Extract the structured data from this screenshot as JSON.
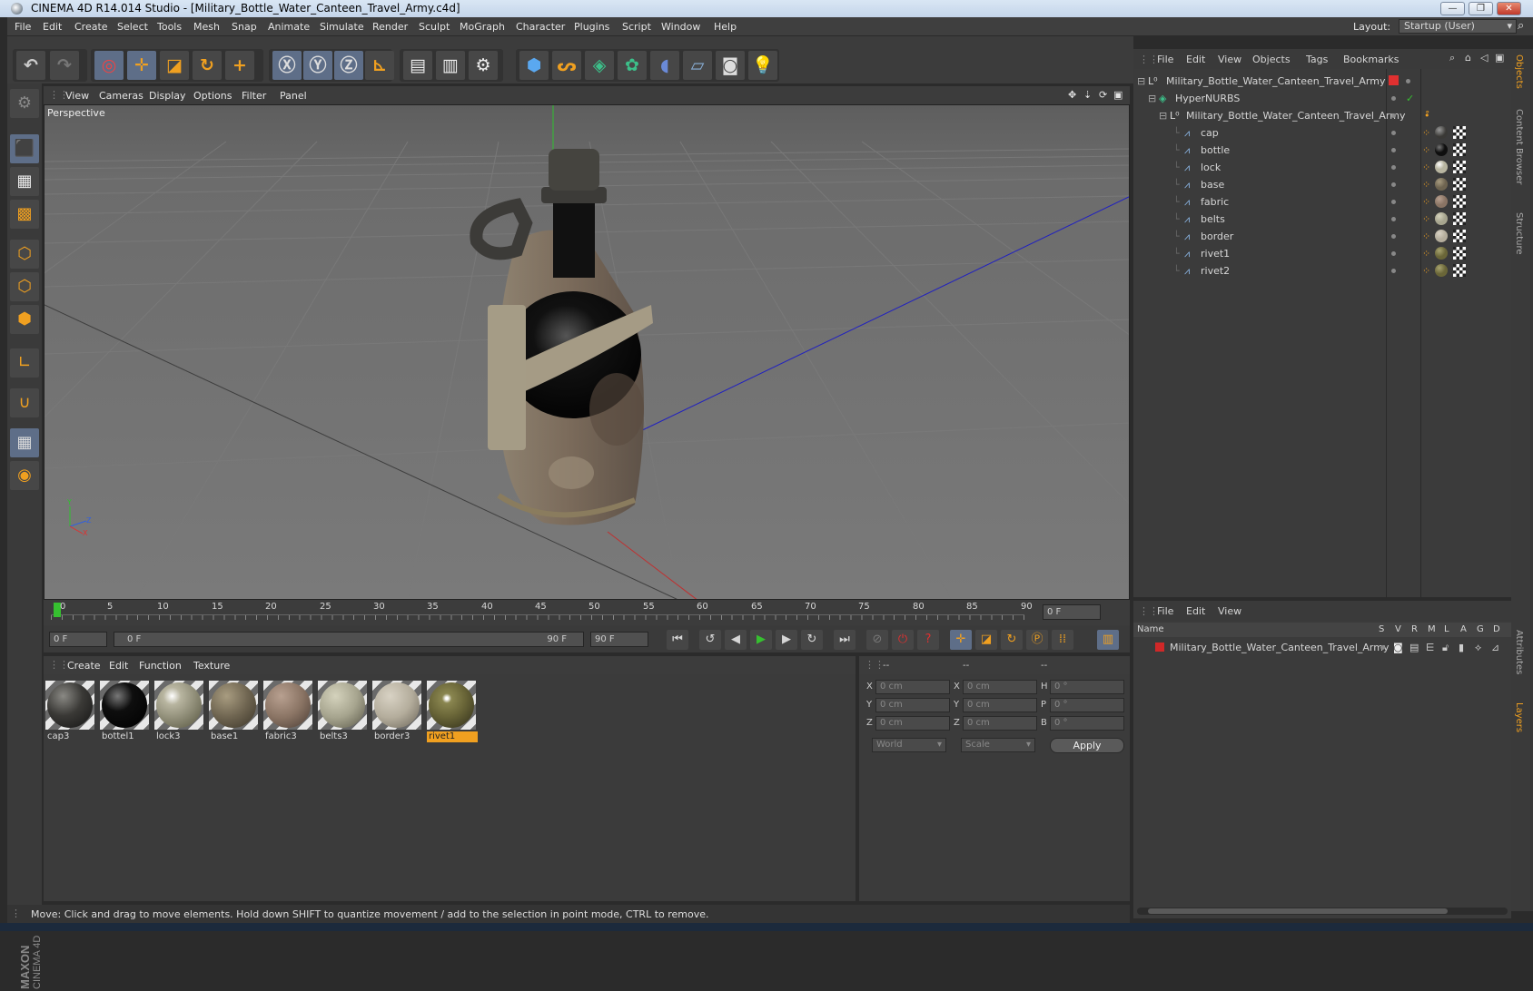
{
  "window": {
    "title": "CINEMA 4D R14.014 Studio - [Military_Bottle_Water_Canteen_Travel_Army.c4d]",
    "minimize": "—",
    "restore": "❐",
    "close": "✕"
  },
  "menubar": {
    "items": [
      "File",
      "Edit",
      "Create",
      "Select",
      "Tools",
      "Mesh",
      "Snap",
      "Animate",
      "Simulate",
      "Render",
      "Sculpt",
      "MoGraph",
      "Character",
      "Plugins",
      "Script",
      "Window",
      "Help"
    ],
    "layout_label": "Layout:",
    "layout_value": "Startup (User)"
  },
  "viewport": {
    "menu": [
      "View",
      "Cameras",
      "Display",
      "Options",
      "Filter",
      "Panel"
    ],
    "label": "Perspective"
  },
  "timeline": {
    "ticks": [
      "0",
      "5",
      "10",
      "15",
      "20",
      "25",
      "30",
      "35",
      "40",
      "45",
      "50",
      "55",
      "60",
      "65",
      "70",
      "75",
      "80",
      "85",
      "90"
    ],
    "current_frame": "0 F",
    "start_field": "0 F",
    "range_start": "0 F",
    "range_end": "90 F",
    "end_field": "90 F"
  },
  "materials": {
    "menu": [
      "Create",
      "Edit",
      "Function",
      "Texture"
    ],
    "items": [
      {
        "name": "cap3",
        "color": "#3a3936"
      },
      {
        "name": "bottel1",
        "color": "#0e0e0e"
      },
      {
        "name": "lock3",
        "color": "#b8b5a0"
      },
      {
        "name": "base1",
        "color": "#6e6450"
      },
      {
        "name": "fabric3",
        "color": "#8a7464"
      },
      {
        "name": "belts3",
        "color": "#a6a48e"
      },
      {
        "name": "border3",
        "color": "#b4ad9c"
      },
      {
        "name": "rivet1",
        "color": "#6a6638"
      }
    ],
    "selected": "rivet1"
  },
  "coords": {
    "headers": [
      "--",
      "--",
      "--"
    ],
    "rows": [
      {
        "a": "X",
        "av": "0 cm",
        "b": "X",
        "bv": "0 cm",
        "c": "H",
        "cv": "0 °"
      },
      {
        "a": "Y",
        "av": "0 cm",
        "b": "Y",
        "bv": "0 cm",
        "c": "P",
        "cv": "0 °"
      },
      {
        "a": "Z",
        "av": "0 cm",
        "b": "Z",
        "bv": "0 cm",
        "c": "B",
        "cv": "0 °"
      }
    ],
    "mode": "World",
    "scale": "Scale",
    "apply": "Apply"
  },
  "objects": {
    "menu": [
      "File",
      "Edit",
      "View",
      "Objects",
      "Tags",
      "Bookmarks"
    ],
    "root": "Military_Bottle_Water_Canteen_Travel_Army",
    "hypernurbs": "HyperNURBS",
    "group": "Military_Bottle_Water_Canteen_Travel_Army",
    "children": [
      {
        "name": "cap",
        "tag": "#3a3936"
      },
      {
        "name": "bottle",
        "tag": "#0e0e0e"
      },
      {
        "name": "lock",
        "tag": "#b8b5a0"
      },
      {
        "name": "base",
        "tag": "#6e6450"
      },
      {
        "name": "fabric",
        "tag": "#8a7464"
      },
      {
        "name": "belts",
        "tag": "#a6a48e"
      },
      {
        "name": "border",
        "tag": "#b4ad9c"
      },
      {
        "name": "rivet1",
        "tag": "#6a6638"
      },
      {
        "name": "rivet2",
        "tag": "#6a6638"
      }
    ]
  },
  "side_tabs": [
    "Objects",
    "Content Browser",
    "Structure",
    "Attributes",
    "Layers"
  ],
  "layers": {
    "menu": [
      "File",
      "Edit",
      "View"
    ],
    "columns": [
      "Name",
      "S",
      "V",
      "R",
      "M",
      "L",
      "A",
      "G",
      "D"
    ],
    "row": "Military_Bottle_Water_Canteen_Travel_Army"
  },
  "status": "Move: Click and drag to move elements. Hold down SHIFT to quantize movement / add to the selection in point mode, CTRL to remove.",
  "logo": {
    "line1": "MAXON",
    "line2": "CINEMA 4D"
  },
  "colors": {
    "accent": "#f0a020",
    "selection": "#f0a020",
    "play": "#36c030",
    "layer_red": "#d02828"
  }
}
